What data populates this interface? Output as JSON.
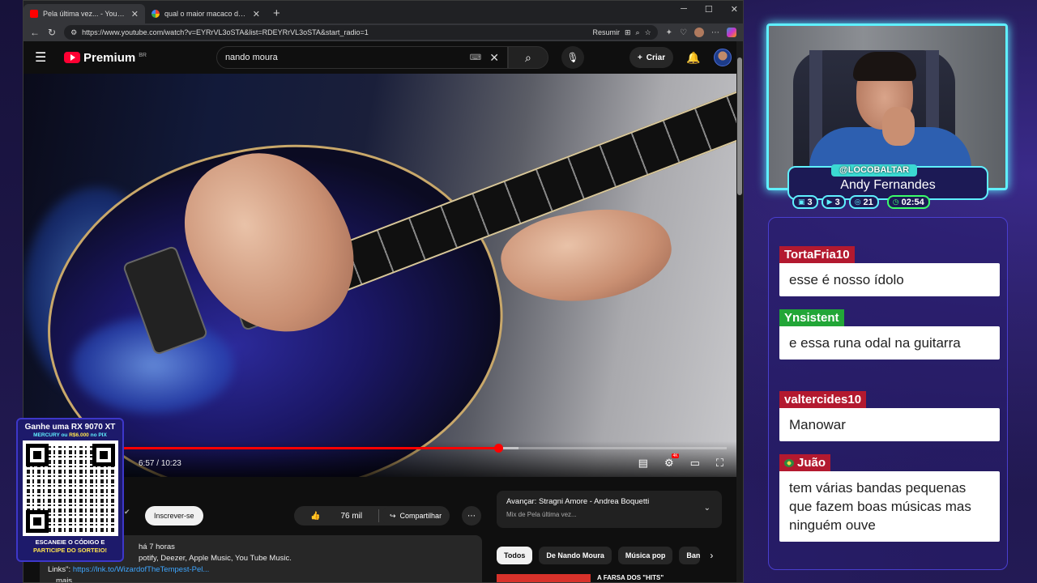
{
  "browser": {
    "tabs": [
      {
        "title": "Pela última vez... - YouTube",
        "active": true
      },
      {
        "title": "qual o maior macaco do mundo",
        "active": false
      }
    ],
    "url": "https://www.youtube.com/watch?v=EYRrVL3oSTA&list=RDEYRrVL3oSTA&start_radio=1",
    "summarize_label": "Resumir"
  },
  "youtube": {
    "logo_text": "Premium",
    "region": "BR",
    "search_value": "nando moura",
    "create_label": "Criar"
  },
  "player": {
    "current_time": "6:57",
    "duration": "10:23",
    "progress_fraction": 0.67,
    "buffered_fraction": 0.7
  },
  "below": {
    "subscribe_label": "Inscrever-se",
    "likes": "76 mil",
    "share_label": "Compartilhar",
    "desc_line1": "há 7 horas",
    "desc_line2": "potify, Deezer, Apple Music, You Tube Music.",
    "desc_links_label": "Links\":",
    "desc_link": "https://lnk.to/WizardofTheTempest-Pel...",
    "desc_more": "mais",
    "next_title": "Avançar: Stragni Amore - Andrea Boquetti",
    "next_sub": "Mix de Pela última vez...",
    "chips": [
      "Todos",
      "De Nando Moura",
      "Música pop",
      "Ban"
    ],
    "reco_title": "A FARSA DOS \"HITS\""
  },
  "qr": {
    "line1": "Ganhe uma RX 9070 XT",
    "line2a": "MERCURY ou ",
    "line2b": "R$6.000",
    "line2c": " no PIX",
    "line3a": "ESCANEIE O CÓDIGO E",
    "line3b": "PARTICIPE DO SORTEIO!"
  },
  "streamer": {
    "handle": "@LOCOBALTAR",
    "name": "Andy Fernandes",
    "stats": [
      {
        "icon": "chat-icon",
        "value": "3"
      },
      {
        "icon": "video-icon",
        "value": "3"
      },
      {
        "icon": "follow-icon",
        "value": "21"
      },
      {
        "icon": "clock-icon",
        "value": "02:54"
      }
    ]
  },
  "chat": {
    "messages": [
      {
        "user": "TortaFria10",
        "color": "#b3192f",
        "text": "esse é nosso ídolo"
      },
      {
        "user": "Ynsistent",
        "color": "#22a637",
        "text": "e essa runa odal na guitarra"
      },
      {
        "user": "valtercides10",
        "color": "#b3192f",
        "text": "Manowar"
      },
      {
        "user": "Juão",
        "color": "#b3192f",
        "text": "tem várias bandas pequenas que fazem boas músicas mas ninguém ouve"
      }
    ]
  }
}
